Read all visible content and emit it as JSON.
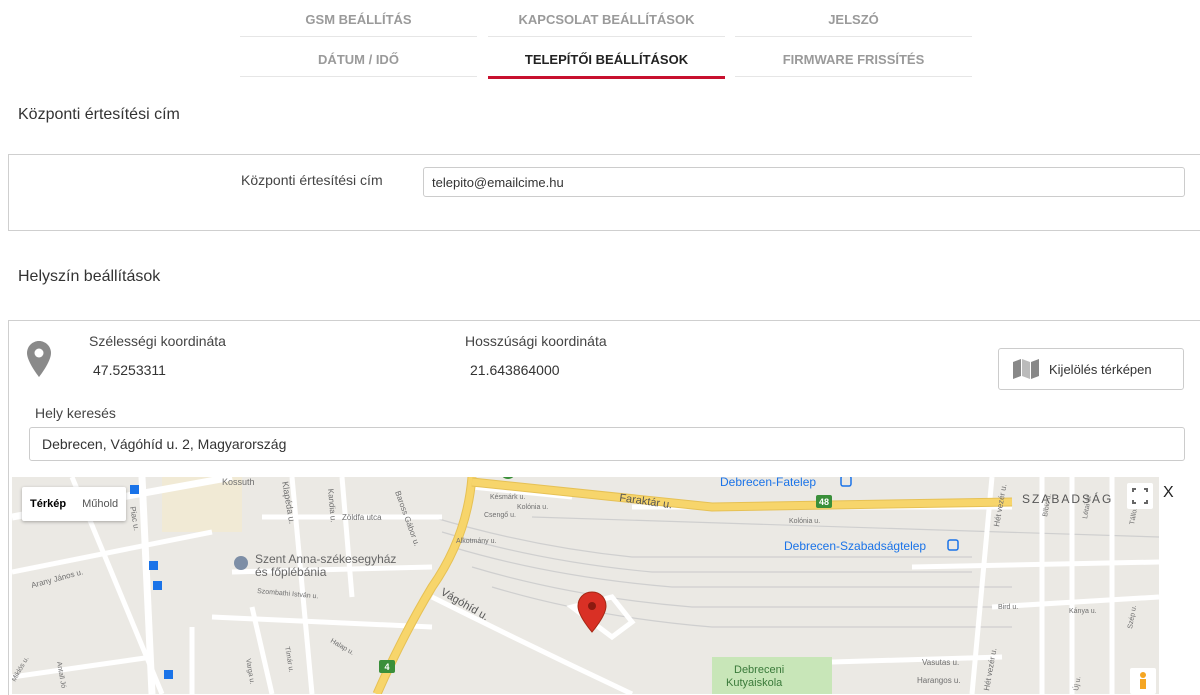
{
  "tabs": {
    "row1": [
      {
        "label": "GSM BEÁLLÍTÁS",
        "active": false
      },
      {
        "label": "KAPCSOLAT BEÁLLÍTÁSOK",
        "active": false
      },
      {
        "label": "JELSZÓ",
        "active": false
      }
    ],
    "row2": [
      {
        "label": "DÁTUM / IDŐ",
        "active": false
      },
      {
        "label": "TELEPÍTŐI BEÁLLÍTÁSOK",
        "active": true
      },
      {
        "label": "FIRMWARE FRISSÍTÉS",
        "active": false
      }
    ]
  },
  "notify": {
    "section_title": "Központi értesítési cím",
    "field_label": "Központi értesítési cím",
    "field_value": "telepito@emailcime.hu"
  },
  "location": {
    "section_title": "Helyszín beállítások",
    "lat_label": "Szélességi koordináta",
    "lat_value": "47.5253311",
    "lng_label": "Hosszúsági koordináta",
    "lng_value": "21.643864000",
    "map_select_button": "Kijelölés térképen",
    "search_label": "Hely keresés",
    "search_value": "Debrecen, Vágóhíd u. 2, Magyarország"
  },
  "map": {
    "type_map": "Térkép",
    "type_satellite": "Műhold",
    "close_label": "X",
    "labels": {
      "kossuth": "Kossuth",
      "klapeda": "Klapéda u.",
      "kandia": "Kandia u.",
      "zoldfa": "Zöldfa utca",
      "baross": "Baross Gábor u.",
      "kesmark": "Késmárk u.",
      "csengo": "Csengő u.",
      "kolonia1": "Kolónia u.",
      "alkotmany": "Alkotmány u.",
      "faraktar": "Faraktár u.",
      "fatelep": "Debrecen-Fatelep",
      "road48": "48",
      "kolonia2": "Kolónia u.",
      "szabadsag": "SZABADSÁG",
      "bibic": "Bíbic u.",
      "letai": "Létai út",
      "tallos": "Tállos u.",
      "hetvezer": "Hét vezér u.",
      "szabadsagtelep": "Debrecen-Szabadságtelep",
      "piac": "Piac u.",
      "szent_anna_1": "Szent Anna-székesegyház",
      "szent_anna_2": "és főplébánia",
      "szombathi": "Szombathi István u.",
      "arany": "Arany János u.",
      "vagohid": "Vágóhíd u.",
      "bird": "Bird u.",
      "kanya": "Kánya u.",
      "szep": "Szép u.",
      "halap": "Halap u.",
      "timar": "Tímár u.",
      "varga": "Varga u.",
      "antall": "Antall Jó",
      "miklos": "Miklós u.",
      "vasutas": "Vasutas u.",
      "harangos": "Harangos u.",
      "debreceni": "Debreceni",
      "kutyaiskola": "Kutyaiskola",
      "road4": "4",
      "hetvezer2": "Hét vezér u.",
      "uj": "Új u."
    }
  },
  "colors": {
    "accent": "#c8102e",
    "pin": "#d93025",
    "major_road": "#f7d56b",
    "transit_blue": "#1a73e8"
  }
}
